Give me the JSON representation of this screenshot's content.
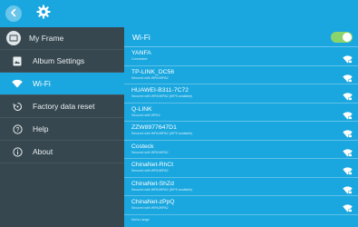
{
  "header": {
    "back_icon": "back-arrow-icon",
    "settings_icon": "gear-icon"
  },
  "sidebar": {
    "items": [
      {
        "label": "My Frame",
        "icon": "frame-icon"
      },
      {
        "label": "Album Settings",
        "icon": "album-icon"
      },
      {
        "label": "Wi-Fi",
        "icon": "wifi-icon",
        "active": true
      },
      {
        "label": "Factory data reset",
        "icon": "reset-icon"
      },
      {
        "label": "Help",
        "icon": "help-icon"
      },
      {
        "label": "About",
        "icon": "info-icon"
      }
    ]
  },
  "wifi": {
    "title": "Wi-Fi",
    "enabled": true,
    "networks": [
      {
        "name": "YANFA",
        "status": "Connected"
      },
      {
        "name": "TP-LINK_DC56",
        "status": "Secured with WPA/WPA2"
      },
      {
        "name": "HUAWEI-B311-7C72",
        "status": "Secured with WPA/WPA2 (WPS available)"
      },
      {
        "name": "Q-LINK",
        "status": "Secured with WPA2"
      },
      {
        "name": "ZZW8977647D1",
        "status": "Secured with WPA/WPA2 (WPS available)"
      },
      {
        "name": "Costeck",
        "status": "Secured with WPA/WPA2"
      },
      {
        "name": "ChinaNet-RhCt",
        "status": "Secured with WPA/WPA2"
      },
      {
        "name": "ChinaNet-ShZd",
        "status": "Secured with WPA/WPA2 (WPS available)"
      },
      {
        "name": "ChinaNet-zPpQ",
        "status": "Secured with WPA/WPA2"
      },
      {
        "name": "",
        "status": "Not in range"
      }
    ]
  },
  "colors": {
    "accent": "#1aa7df",
    "sidebar": "#37474f",
    "toggle_on": "#8bd46b"
  }
}
